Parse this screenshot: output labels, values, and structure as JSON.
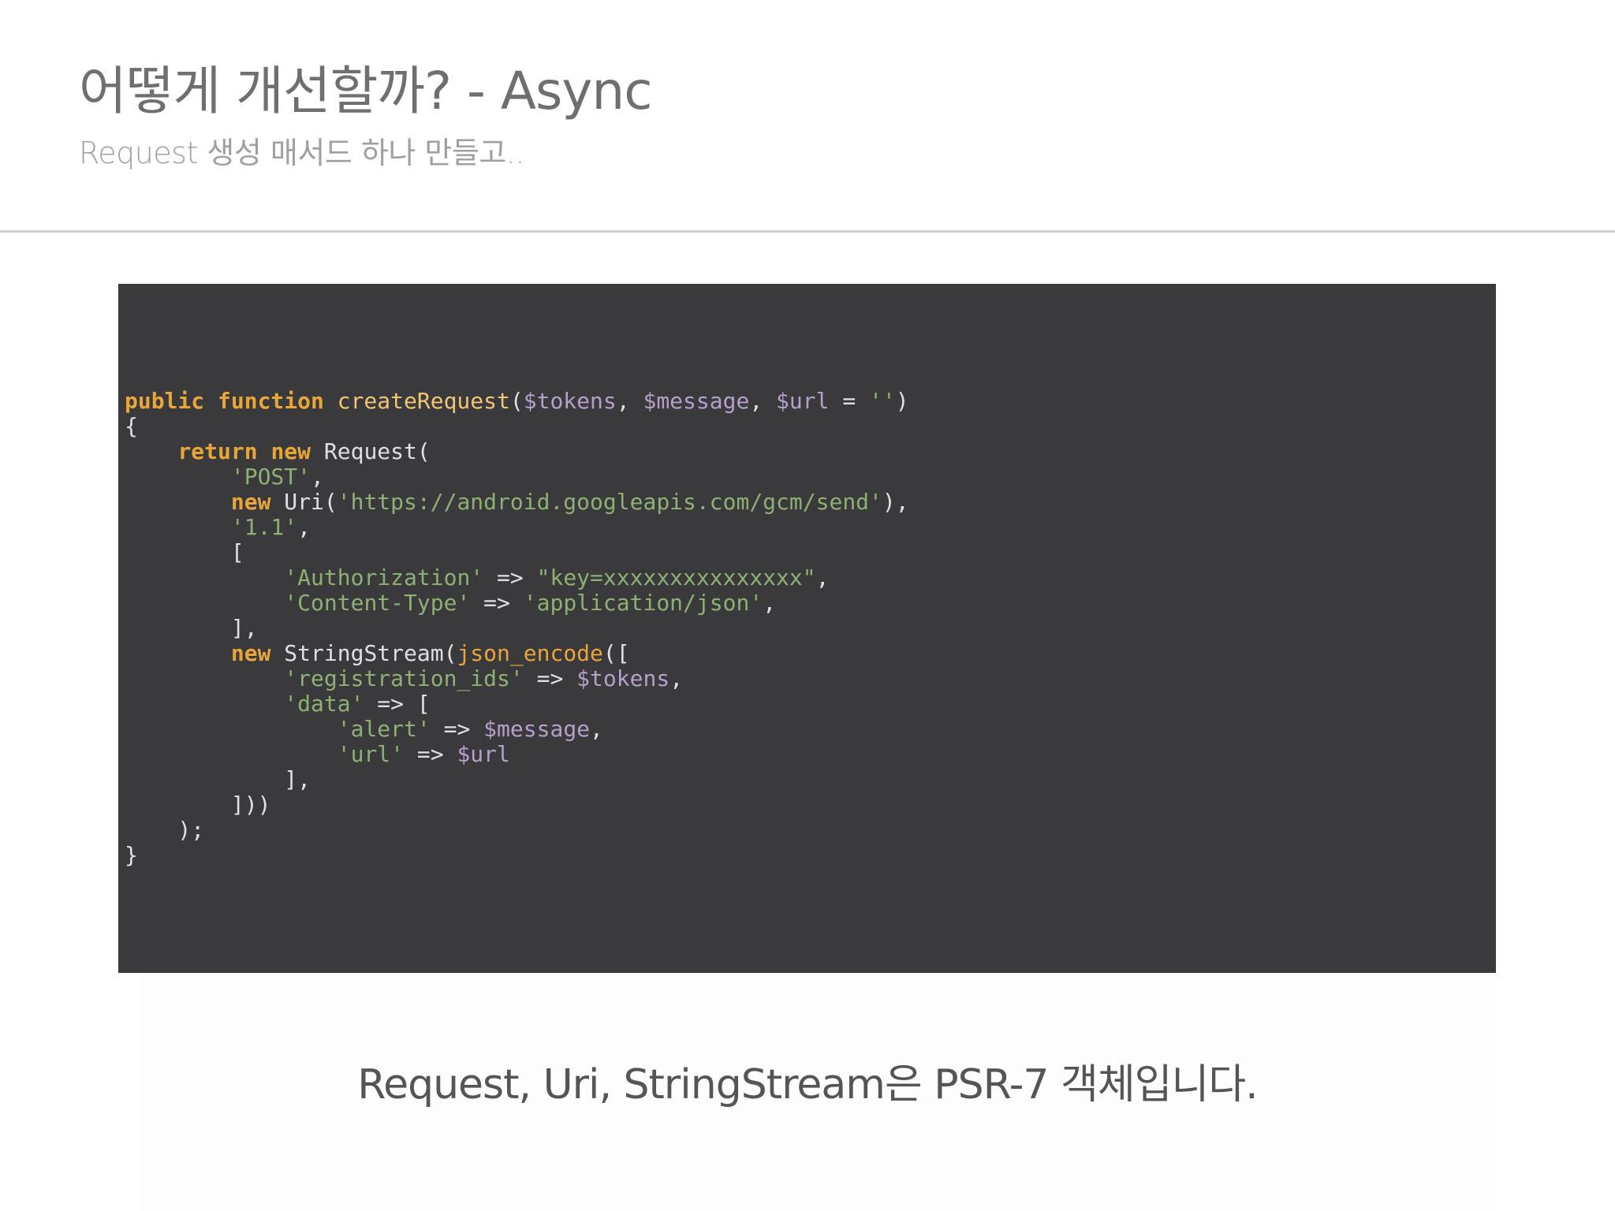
{
  "slide": {
    "title": "어떻게 개선할까?  - Async",
    "subtitle": "Request 생성 매서드 하나 만들고..",
    "caption": "Request, Uri, StringStream은 PSR-7 객체입니다."
  },
  "colors": {
    "background": "#ffffff",
    "title": "#6f6f6f",
    "subtitle": "#a0a0a0",
    "divider": "#cfcfcf",
    "code_background": "#3a393b",
    "keyword": "#e8a53a",
    "function_name": "#f0c674",
    "variable": "#b59fcb",
    "string": "#8fb074",
    "plain": "#e0e0e0"
  },
  "code": {
    "language": "php",
    "lines": [
      [
        [
          "kw",
          "public function "
        ],
        [
          "fn",
          "createRequest"
        ],
        [
          "plain",
          "("
        ],
        [
          "var",
          "$tokens"
        ],
        [
          "plain",
          ", "
        ],
        [
          "var",
          "$message"
        ],
        [
          "plain",
          ", "
        ],
        [
          "var",
          "$url"
        ],
        [
          "plain",
          " = "
        ],
        [
          "str",
          "''"
        ],
        [
          "plain",
          ")"
        ]
      ],
      [
        [
          "plain",
          "{"
        ]
      ],
      [
        [
          "plain",
          "    "
        ],
        [
          "kw",
          "return new "
        ],
        [
          "plain",
          "Request("
        ]
      ],
      [
        [
          "plain",
          "        "
        ],
        [
          "str",
          "'POST'"
        ],
        [
          "plain",
          ","
        ]
      ],
      [
        [
          "plain",
          "        "
        ],
        [
          "kw",
          "new "
        ],
        [
          "plain",
          "Uri("
        ],
        [
          "str",
          "'https://android.googleapis.com/gcm/send'"
        ],
        [
          "plain",
          "),"
        ]
      ],
      [
        [
          "plain",
          "        "
        ],
        [
          "str",
          "'1.1'"
        ],
        [
          "plain",
          ","
        ]
      ],
      [
        [
          "plain",
          "        ["
        ]
      ],
      [
        [
          "plain",
          "            "
        ],
        [
          "str",
          "'Authorization'"
        ],
        [
          "plain",
          " => "
        ],
        [
          "str",
          "\"key=xxxxxxxxxxxxxxx\""
        ],
        [
          "plain",
          ","
        ]
      ],
      [
        [
          "plain",
          "            "
        ],
        [
          "str",
          "'Content-Type'"
        ],
        [
          "plain",
          " => "
        ],
        [
          "str",
          "'application/json'"
        ],
        [
          "plain",
          ","
        ]
      ],
      [
        [
          "plain",
          "        ],"
        ]
      ],
      [
        [
          "plain",
          "        "
        ],
        [
          "kw",
          "new "
        ],
        [
          "plain",
          "StringStream("
        ],
        [
          "bi",
          "json_encode"
        ],
        [
          "plain",
          "(["
        ]
      ],
      [
        [
          "plain",
          "            "
        ],
        [
          "str",
          "'registration_ids'"
        ],
        [
          "plain",
          " => "
        ],
        [
          "var",
          "$tokens"
        ],
        [
          "plain",
          ","
        ]
      ],
      [
        [
          "plain",
          "            "
        ],
        [
          "str",
          "'data'"
        ],
        [
          "plain",
          " => ["
        ]
      ],
      [
        [
          "plain",
          "                "
        ],
        [
          "str",
          "'alert'"
        ],
        [
          "plain",
          " => "
        ],
        [
          "var",
          "$message"
        ],
        [
          "plain",
          ","
        ]
      ],
      [
        [
          "plain",
          "                "
        ],
        [
          "str",
          "'url'"
        ],
        [
          "plain",
          " => "
        ],
        [
          "var",
          "$url"
        ]
      ],
      [
        [
          "plain",
          "            ],"
        ]
      ],
      [
        [
          "plain",
          "        ]))"
        ]
      ],
      [
        [
          "plain",
          "    );"
        ]
      ],
      [
        [
          "plain",
          "}"
        ]
      ]
    ]
  }
}
